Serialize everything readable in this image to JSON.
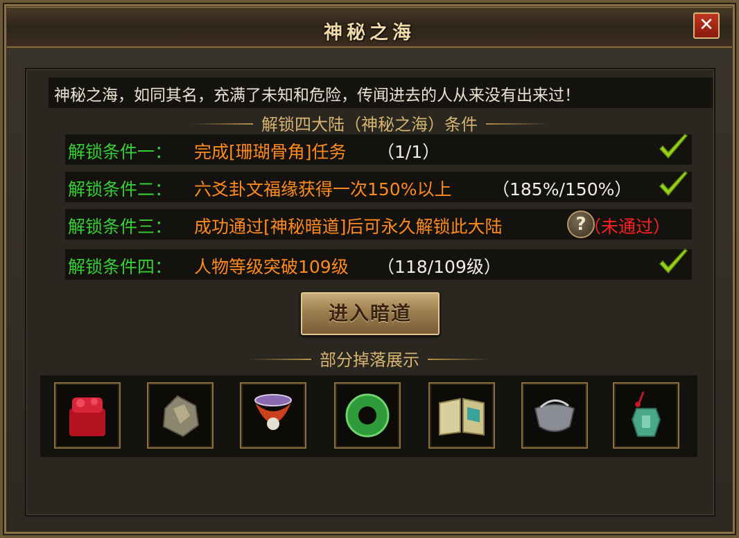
{
  "window": {
    "title": "神秘之海",
    "close_label": "✕"
  },
  "description": "神秘之海，如同其名，充满了未知和危险，传闻进去的人从来没有出来过！",
  "conditions_header": "解锁四大陆（神秘之海）条件",
  "conditions": [
    {
      "label": "解锁条件一：",
      "task": "完成[珊瑚骨角]任务",
      "progress": "（1/1）",
      "status": "done"
    },
    {
      "label": "解锁条件二：",
      "task": "六爻卦文福缘获得一次150%以上",
      "progress": "（185%/150%）",
      "status": "done"
    },
    {
      "label": "解锁条件三：",
      "task": "成功通过[神秘暗道]后可永久解锁此大陆",
      "help": "?",
      "progress": "（未通过）",
      "status": "failed"
    },
    {
      "label": "解锁条件四：",
      "task": "人物等级突破109级",
      "progress": "（118/109级）",
      "status": "done"
    }
  ],
  "enter_button": "进入暗道",
  "drops_header": "部分掉落展示",
  "drops": [
    {
      "icon": "red-seal-icon"
    },
    {
      "icon": "stone-ore-icon"
    },
    {
      "icon": "ornate-belt-icon"
    },
    {
      "icon": "jade-ring-icon"
    },
    {
      "icon": "open-book-icon"
    },
    {
      "icon": "cloth-bag-icon"
    },
    {
      "icon": "jade-pendant-icon"
    }
  ],
  "colors": {
    "condition_label": "#35d035",
    "task": "#ff8a1c",
    "progress": "#f2efe6",
    "failed": "#ff2020",
    "check": "#9ad21a",
    "header": "#d7b46f"
  }
}
